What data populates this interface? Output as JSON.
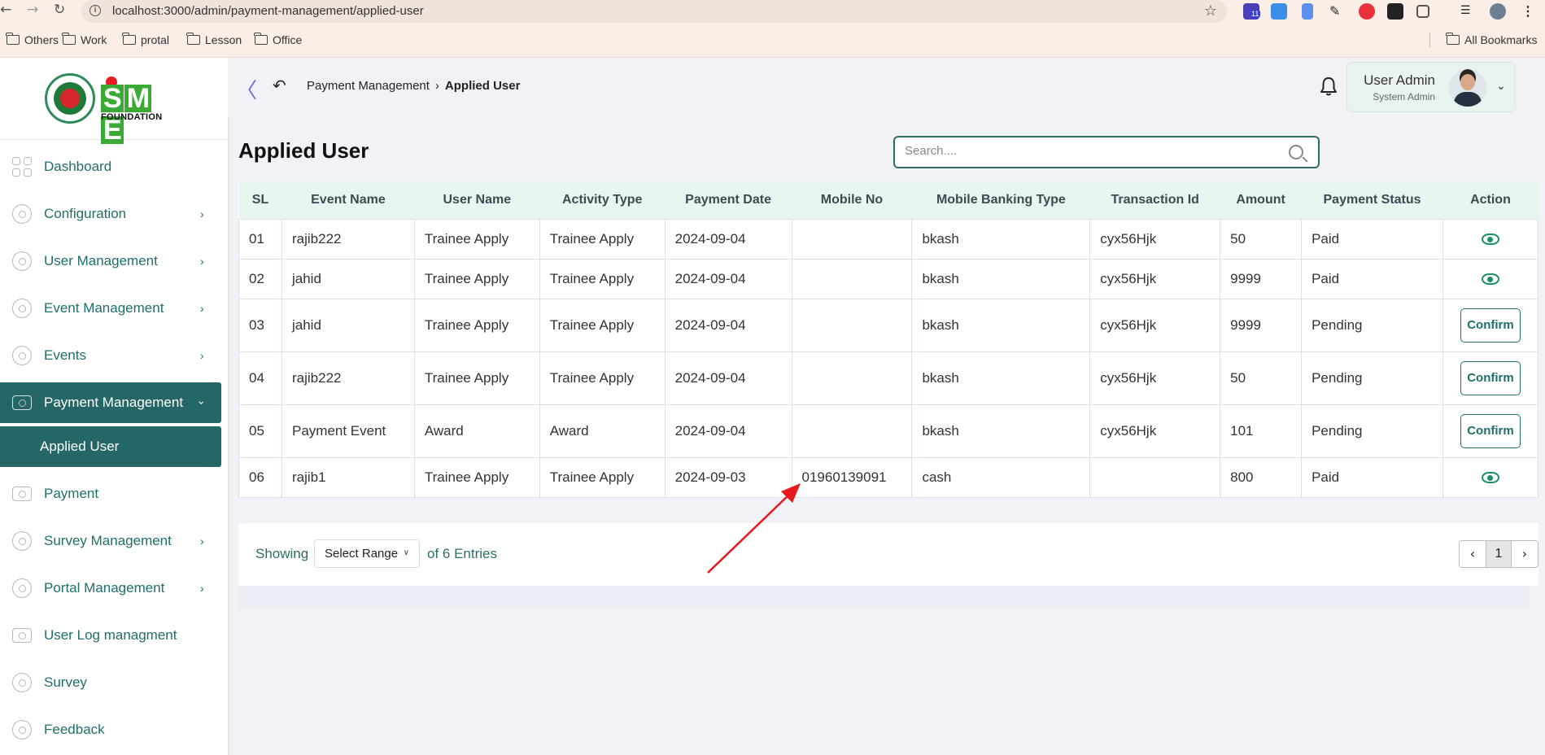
{
  "browser": {
    "url": "localhost:3000/admin/payment-management/applied-user",
    "bookmarks": [
      "Others",
      "Work",
      "protal",
      "Lesson",
      "Office"
    ],
    "all_bookmarks": "All Bookmarks",
    "ext_badge": "11"
  },
  "brand": {
    "logo_text": [
      "S",
      "M",
      "E"
    ],
    "foundation": "FOUNDATION"
  },
  "sidebar": {
    "items": [
      {
        "label": "Dashboard",
        "icon": "dashboard-icon",
        "has_chevron": false
      },
      {
        "label": "Configuration",
        "icon": "configuration-icon",
        "has_chevron": true
      },
      {
        "label": "User Management",
        "icon": "user-management-icon",
        "has_chevron": true
      },
      {
        "label": "Event Management",
        "icon": "event-management-icon",
        "has_chevron": true
      },
      {
        "label": "Events",
        "icon": "events-icon",
        "has_chevron": true
      },
      {
        "label": "Payment Management",
        "icon": "payment-management-icon",
        "has_chevron": true,
        "active": true
      },
      {
        "label": "Payment",
        "icon": "payment-icon",
        "has_chevron": false
      },
      {
        "label": "Survey Management",
        "icon": "survey-management-icon",
        "has_chevron": true
      },
      {
        "label": "Portal Management",
        "icon": "portal-management-icon",
        "has_chevron": true
      },
      {
        "label": "User Log managment",
        "icon": "user-log-icon",
        "has_chevron": false
      },
      {
        "label": "Survey",
        "icon": "survey-icon",
        "has_chevron": false
      },
      {
        "label": "Feedback",
        "icon": "feedback-icon",
        "has_chevron": false
      }
    ],
    "submenu": {
      "label": "Applied User"
    }
  },
  "header": {
    "breadcrumb": [
      "Payment Management",
      "Applied User"
    ],
    "user_name": "User Admin",
    "user_role": "System Admin"
  },
  "main": {
    "title": "Applied User",
    "search_placeholder": "Search...."
  },
  "table": {
    "columns": [
      "SL",
      "Event Name",
      "User Name",
      "Activity Type",
      "Payment Date",
      "Mobile No",
      "Mobile Banking Type",
      "Transaction Id",
      "Amount",
      "Payment Status",
      "Action"
    ],
    "rows": [
      {
        "sl": "01",
        "event": "rajib222",
        "user": "Trainee Apply",
        "activity": "Trainee Apply",
        "date": "2024-09-04",
        "mobile": "",
        "banking": "bkash",
        "txn": "cyx56Hjk",
        "amount": "50",
        "status": "Paid",
        "action": "view"
      },
      {
        "sl": "02",
        "event": "jahid",
        "user": "Trainee Apply",
        "activity": "Trainee Apply",
        "date": "2024-09-04",
        "mobile": "",
        "banking": "bkash",
        "txn": "cyx56Hjk",
        "amount": "9999",
        "status": "Paid",
        "action": "view"
      },
      {
        "sl": "03",
        "event": "jahid",
        "user": "Trainee Apply",
        "activity": "Trainee Apply",
        "date": "2024-09-04",
        "mobile": "",
        "banking": "bkash",
        "txn": "cyx56Hjk",
        "amount": "9999",
        "status": "Pending",
        "action": "Confirm"
      },
      {
        "sl": "04",
        "event": "rajib222",
        "user": "Trainee Apply",
        "activity": "Trainee Apply",
        "date": "2024-09-04",
        "mobile": "",
        "banking": "bkash",
        "txn": "cyx56Hjk",
        "amount": "50",
        "status": "Pending",
        "action": "Confirm"
      },
      {
        "sl": "05",
        "event": "Payment Event",
        "user": "Award",
        "activity": "Award",
        "date": "2024-09-04",
        "mobile": "",
        "banking": "bkash",
        "txn": "cyx56Hjk",
        "amount": "101",
        "status": "Pending",
        "action": "Confirm"
      },
      {
        "sl": "06",
        "event": "rajib1",
        "user": "Trainee Apply",
        "activity": "Trainee Apply",
        "date": "2024-09-03",
        "mobile": "01960139091",
        "banking": "cash",
        "txn": "",
        "amount": "800",
        "status": "Paid",
        "action": "view"
      }
    ]
  },
  "pagination": {
    "showing": "Showing",
    "range_label": "Select Range",
    "entries": "of 6 Entries",
    "page": "1"
  },
  "colors": {
    "primary": "#256767",
    "accent_green": "#1d8f6a",
    "annotation_arrow": "#e8191c"
  }
}
